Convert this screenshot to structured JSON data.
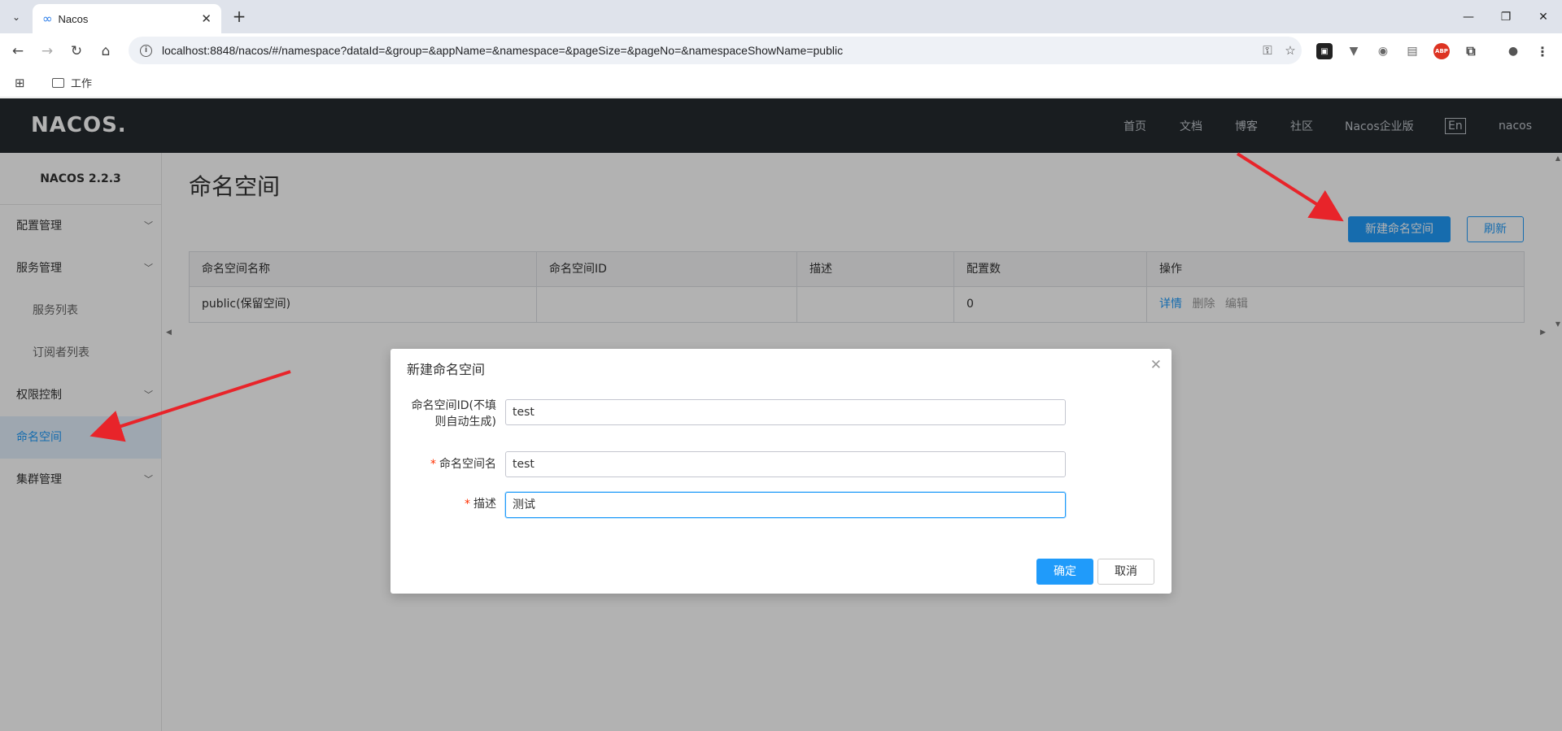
{
  "browser": {
    "tab_title": "Nacos",
    "tab_favicon": "infinity-icon",
    "url": "localhost:8848/nacos/#/namespace?dataId=&group=&appName=&namespace=&pageSize=&pageNo=&namespaceShowName=public",
    "bookmark_folder": "工作"
  },
  "header": {
    "logo": "NACOS.",
    "nav": [
      "首页",
      "文档",
      "博客",
      "社区",
      "Nacos企业版"
    ],
    "lang": "En",
    "user": "nacos"
  },
  "sidebar": {
    "version": "NACOS 2.2.3",
    "items": [
      {
        "label": "配置管理"
      },
      {
        "label": "服务管理"
      },
      {
        "label": "服务列表"
      },
      {
        "label": "订阅者列表"
      },
      {
        "label": "权限控制"
      },
      {
        "label": "命名空间"
      },
      {
        "label": "集群管理"
      }
    ]
  },
  "main": {
    "title": "命名空间",
    "new_button": "新建命名空间",
    "refresh_button": "刷新",
    "table": {
      "columns": [
        "命名空间名称",
        "命名空间ID",
        "描述",
        "配置数",
        "操作"
      ],
      "rows": [
        {
          "name": "public(保留空间)",
          "id": "",
          "desc": "",
          "count": "0",
          "actions": [
            "详情",
            "删除",
            "编辑"
          ]
        }
      ]
    }
  },
  "dialog": {
    "title": "新建命名空间",
    "fields": [
      {
        "label": "命名空间ID(不填则自动生成)",
        "label_line1": "命名空间ID(不填",
        "label_line2": "则自动生成)",
        "value": "test",
        "required": false
      },
      {
        "label": "命名空间名",
        "value": "test",
        "required": true
      },
      {
        "label": "描述",
        "value": "测试",
        "required": true
      }
    ],
    "ok_button": "确定",
    "cancel_button": "取消"
  },
  "colors": {
    "accent": "#209bfa",
    "header_bg": "#252a2f",
    "annotation_arrow": "#e8242a"
  }
}
